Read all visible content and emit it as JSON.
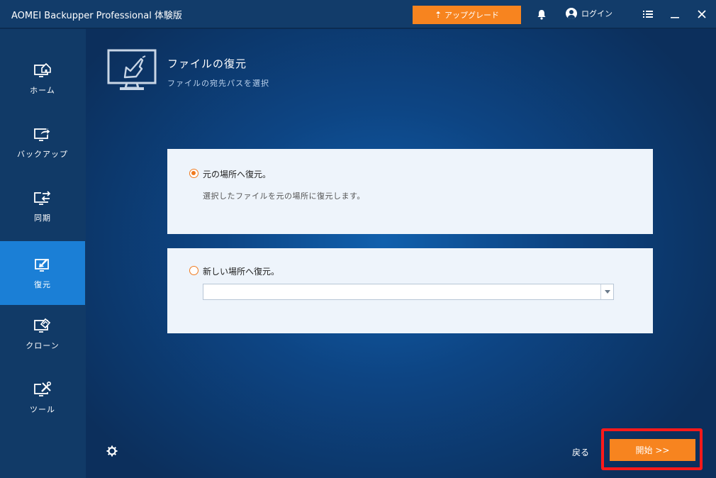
{
  "app": {
    "title": "AOMEI Backupper Professional 体験版"
  },
  "titlebar": {
    "upgrade_label": "アップグレード",
    "login_label": "ログイン"
  },
  "sidebar": {
    "items": [
      {
        "label": "ホーム",
        "icon": "home-monitor-icon"
      },
      {
        "label": "バックアップ",
        "icon": "backup-monitor-icon"
      },
      {
        "label": "同期",
        "icon": "sync-monitor-icon"
      },
      {
        "label": "復元",
        "icon": "restore-monitor-icon",
        "active": true
      },
      {
        "label": "クローン",
        "icon": "clone-monitor-icon"
      },
      {
        "label": "ツール",
        "icon": "tools-monitor-icon"
      }
    ]
  },
  "main": {
    "title": "ファイルの復元",
    "subtitle": "ファイルの宛先パスを選択",
    "option_original": {
      "label": "元の場所へ復元。",
      "description": "選択したファイルを元の場所に復元します。",
      "checked": true
    },
    "option_new": {
      "label": "新しい場所へ復元。",
      "path_value": "",
      "checked": false
    },
    "back_label": "戻る",
    "start_label": "開始 >>"
  },
  "colors": {
    "accent": "#f7841f",
    "active_nav": "#1b7fd6",
    "highlight_border": "#ff1a1a"
  }
}
